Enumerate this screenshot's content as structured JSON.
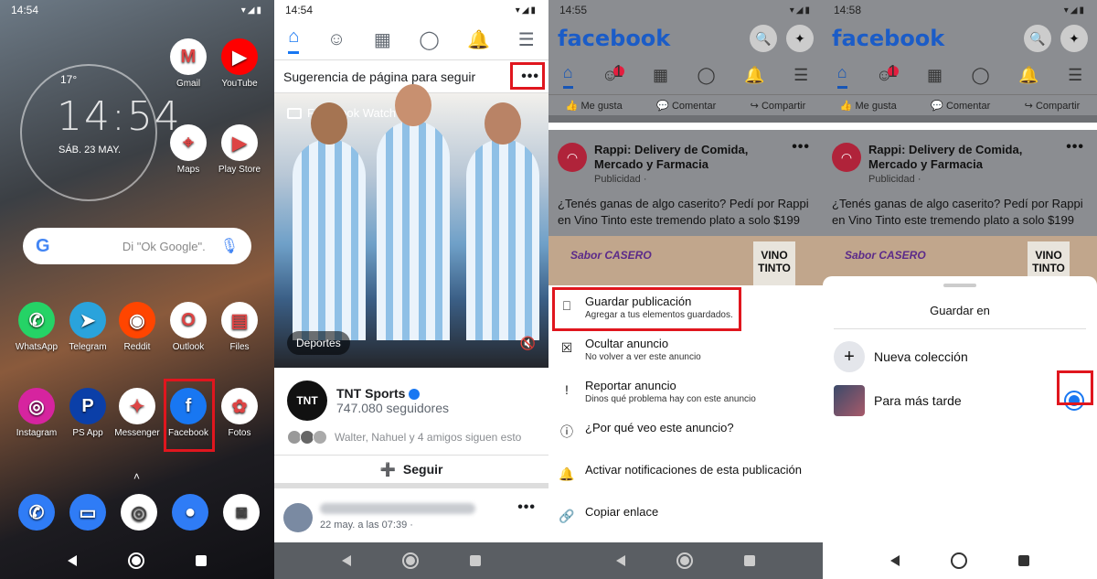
{
  "panel1": {
    "status_time": "14:54",
    "clock": {
      "time": "14:54",
      "temp": "17°",
      "date": "SÁB. 23 MAY."
    },
    "search_placeholder": "Di \"Ok Google\".",
    "apps": [
      {
        "label": "Gmail",
        "icon": "gmail-icon",
        "color": "#ffffff",
        "glyph": "M"
      },
      {
        "label": "YouTube",
        "icon": "youtube-icon",
        "color": "#ff0000",
        "glyph": "▶"
      },
      {
        "label": "Maps",
        "icon": "maps-icon",
        "color": "#ffffff",
        "glyph": "⌖"
      },
      {
        "label": "Play Store",
        "icon": "play-store-icon",
        "color": "#ffffff",
        "glyph": "▶"
      },
      {
        "label": "WhatsApp",
        "icon": "whatsapp-icon",
        "color": "#25d366",
        "glyph": "✆"
      },
      {
        "label": "Telegram",
        "icon": "telegram-icon",
        "color": "#2aa3dc",
        "glyph": "➤"
      },
      {
        "label": "Reddit",
        "icon": "reddit-icon",
        "color": "#ff4500",
        "glyph": "◉"
      },
      {
        "label": "Outlook",
        "icon": "outlook-icon",
        "color": "#ffffff",
        "glyph": "O"
      },
      {
        "label": "Files",
        "icon": "files-icon",
        "color": "#ffffff",
        "glyph": "▤"
      },
      {
        "label": "Instagram",
        "icon": "instagram-icon",
        "color": "#d6249f",
        "glyph": "◎"
      },
      {
        "label": "PS App",
        "icon": "ps-app-icon",
        "color": "#0b3fa8",
        "glyph": "P"
      },
      {
        "label": "Messenger",
        "icon": "messenger-icon",
        "color": "#ffffff",
        "glyph": "✦"
      },
      {
        "label": "Facebook",
        "icon": "facebook-icon",
        "color": "#1877f2",
        "glyph": "f"
      },
      {
        "label": "Fotos",
        "icon": "photos-icon",
        "color": "#ffffff",
        "glyph": "✿"
      }
    ],
    "dock": [
      {
        "icon": "phone-icon",
        "color": "#2f7cf6",
        "glyph": "✆"
      },
      {
        "icon": "messages-icon",
        "color": "#2f7cf6",
        "glyph": "▭"
      },
      {
        "icon": "chrome-icon",
        "color": "#ffffff",
        "glyph": "◎"
      },
      {
        "icon": "contacts-icon",
        "color": "#2f7cf6",
        "glyph": "●"
      },
      {
        "icon": "camera-icon",
        "color": "#ffffff",
        "glyph": "◙"
      }
    ]
  },
  "panel2": {
    "status_time": "14:54",
    "suggestion": "Sugerencia de página para seguir",
    "more": "•••",
    "watch_label": "Facebook Watch",
    "category_chip": "Deportes",
    "page_name": "TNT Sports",
    "logo_text": "TNT",
    "followers": "747.080 seguidores",
    "friends": "Walter, Nahuel y 4 amigos siguen esto",
    "follow_label": "Seguir",
    "next_post_time": "22 may. a las 07:39 ·"
  },
  "panel3": {
    "status_time": "14:55",
    "brand": "facebook",
    "badge": "1",
    "actions": [
      "Me gusta",
      "Comentar",
      "Compartir"
    ],
    "ad": {
      "title": "Rappi: Delivery de Comida, Mercado y Farmacia",
      "sub": "Publicidad ·",
      "body": "¿Tenés ganas de algo caserito? Pedí por Rappi en Vino Tinto este tremendo plato a solo $199",
      "img_left": "Sabor CASERO",
      "img_right": "VINO TINTO"
    },
    "menu": [
      {
        "title": "Guardar publicación",
        "desc": "Agregar a tus elementos guardados.",
        "icon": "bookmark-icon",
        "glyph": "⎕"
      },
      {
        "title": "Ocultar anuncio",
        "desc": "No volver a ver este anuncio",
        "icon": "hide-icon",
        "glyph": "☒"
      },
      {
        "title": "Reportar anuncio",
        "desc": "Dinos qué problema hay con este anuncio",
        "icon": "report-icon",
        "glyph": "!"
      },
      {
        "title": "¿Por qué veo este anuncio?",
        "desc": "",
        "icon": "info-icon",
        "glyph": "ⓘ"
      },
      {
        "title": "Activar notificaciones de esta publicación",
        "desc": "",
        "icon": "bell-icon",
        "glyph": "🔔"
      },
      {
        "title": "Copiar enlace",
        "desc": "",
        "icon": "link-icon",
        "glyph": "🔗"
      }
    ]
  },
  "panel4": {
    "status_time": "14:58",
    "sheet_title": "Guardar en",
    "new_collection": "Nueva colección",
    "later": "Para más tarde"
  },
  "colors": {
    "fb_blue": "#1877f2",
    "highlight_red": "#e0161e"
  }
}
